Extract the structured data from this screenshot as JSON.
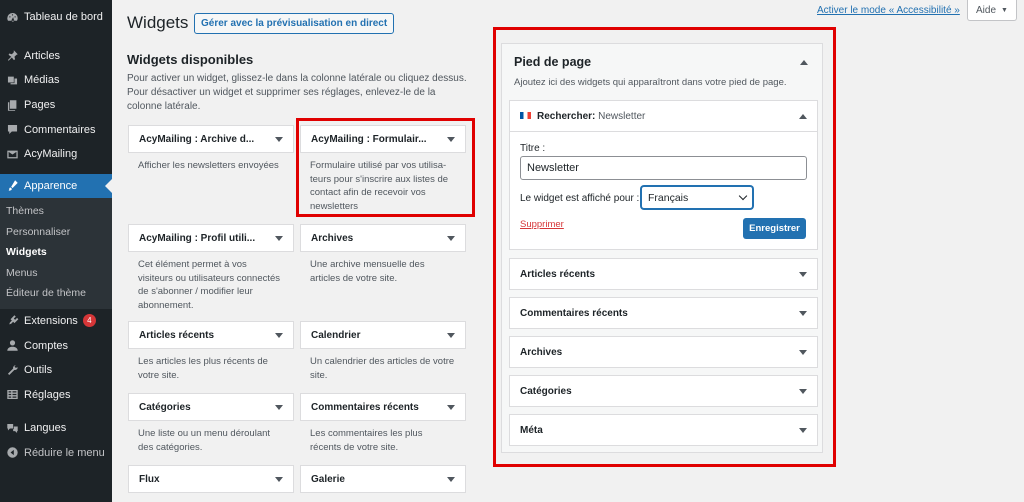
{
  "sidebar": {
    "items": [
      {
        "label": "Tableau de bord",
        "icon": "dashboard-icon"
      },
      {
        "label": "Articles",
        "icon": "pin-icon"
      },
      {
        "label": "Médias",
        "icon": "media-icon"
      },
      {
        "label": "Pages",
        "icon": "pages-icon"
      },
      {
        "label": "Commentaires",
        "icon": "comment-icon"
      },
      {
        "label": "AcyMailing",
        "icon": "acymailing-icon"
      },
      {
        "label": "Apparence",
        "icon": "brush-icon"
      }
    ],
    "submenu": [
      "Thèmes",
      "Personnaliser",
      "Widgets",
      "Menus",
      "Éditeur de thème"
    ],
    "items_after": [
      {
        "label": "Extensions",
        "icon": "plugin-icon",
        "badge": "4"
      },
      {
        "label": "Comptes",
        "icon": "user-icon"
      },
      {
        "label": "Outils",
        "icon": "wrench-icon"
      },
      {
        "label": "Réglages",
        "icon": "settings-icon"
      }
    ],
    "items_bottom": [
      {
        "label": "Langues",
        "icon": "language-icon"
      },
      {
        "label": "Réduire le menu",
        "icon": "collapse-icon"
      }
    ]
  },
  "topbar": {
    "accessibility_link": "Activer le mode « Accessibilité »",
    "help_label": "Aide"
  },
  "header": {
    "title": "Widgets",
    "live_preview_button": "Gérer avec la prévisualisation en direct"
  },
  "available": {
    "title": "Widgets disponibles",
    "description": "Pour activer un widget, glissez-le dans la colonne latérale ou cliquez dessus. Pour désactiver un widget et supprimer ses réglages, enlevez-le de la colonne latérale.",
    "widgets": [
      {
        "name": "AcyMailing : Archive d...",
        "desc": "Afficher les newsletters envoyées"
      },
      {
        "name": "AcyMailing : Formulair...",
        "desc": "Formulaire utilisé par vos utilisa-teurs pour s'inscrire aux listes de contact afin de recevoir vos newsletters"
      },
      {
        "name": "AcyMailing : Profil utili...",
        "desc": "Cet élément permet à vos visiteurs ou utilisateurs connectés de s'abonner / modifier leur abonnement."
      },
      {
        "name": "Archives",
        "desc": "Une archive mensuelle des articles de votre site."
      },
      {
        "name": "Articles récents",
        "desc": "Les articles les plus récents de votre site."
      },
      {
        "name": "Calendrier",
        "desc": "Un calendrier des articles de votre site."
      },
      {
        "name": "Catégories",
        "desc": "Une liste ou un menu déroulant des catégories."
      },
      {
        "name": "Commentaires récents",
        "desc": "Les commentaires les plus récents de votre site."
      },
      {
        "name": "Flux",
        "desc": ""
      },
      {
        "name": "Galerie",
        "desc": ""
      }
    ]
  },
  "footer_area": {
    "title": "Pied de page",
    "description": "Ajoutez ici des widgets qui apparaîtront dans votre pied de page.",
    "open_widget": {
      "title_prefix": "Rechercher:",
      "title_value": "Newsletter",
      "titre_label": "Titre :",
      "titre_value": "Newsletter",
      "lang_label": "Le widget est affiché pour :",
      "lang_value": "Français",
      "delete_label": "Supprimer",
      "save_label": "Enregistrer"
    },
    "widgets": [
      "Articles récents",
      "Commentaires récents",
      "Archives",
      "Catégories",
      "Méta"
    ]
  }
}
